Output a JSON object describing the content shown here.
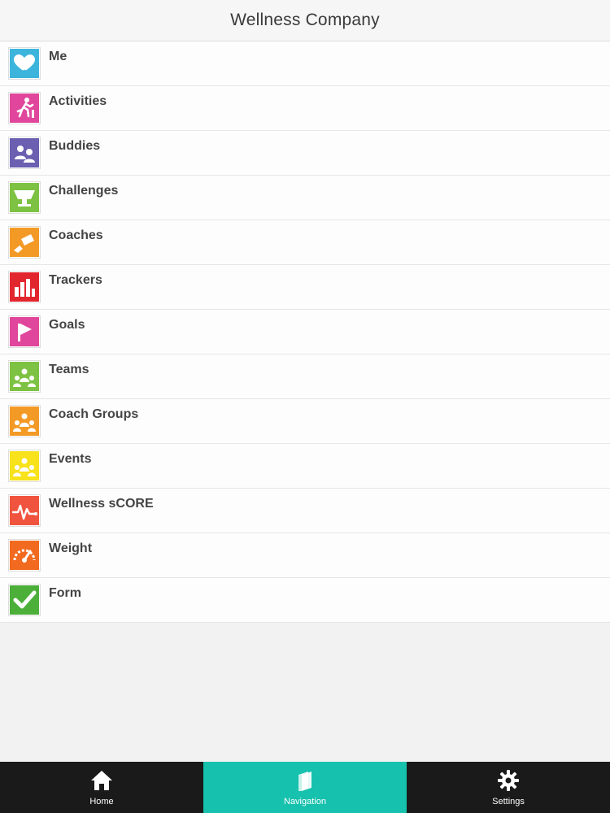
{
  "header": {
    "title": "Wellness Company"
  },
  "menu": [
    {
      "label": "Me",
      "icon": "heart-icon",
      "color": "#3db4dc"
    },
    {
      "label": "Activities",
      "icon": "running-person-icon",
      "color": "#e0469b"
    },
    {
      "label": "Buddies",
      "icon": "buddies-icon",
      "color": "#6a5fb0"
    },
    {
      "label": "Challenges",
      "icon": "trophy-icon",
      "color": "#7dc242"
    },
    {
      "label": "Coaches",
      "icon": "coach-whistle-icon",
      "color": "#f39a26"
    },
    {
      "label": "Trackers",
      "icon": "bar-chart-icon",
      "color": "#e2262e"
    },
    {
      "label": "Goals",
      "icon": "flag-icon",
      "color": "#e0469b"
    },
    {
      "label": "Teams",
      "icon": "team-icon",
      "color": "#7dc242"
    },
    {
      "label": "Coach Groups",
      "icon": "group-icon",
      "color": "#f39a26"
    },
    {
      "label": "Events",
      "icon": "event-group-icon",
      "color": "#f7e21b"
    },
    {
      "label": "Wellness sCORE",
      "icon": "heartbeat-icon",
      "color": "#f0543e"
    },
    {
      "label": "Weight",
      "icon": "gauge-icon",
      "color": "#f26a1f"
    },
    {
      "label": "Form",
      "icon": "checkmark-icon",
      "color": "#4caf3a"
    }
  ],
  "tabs": {
    "home": {
      "label": "Home",
      "icon": "home-icon"
    },
    "navigation": {
      "label": "Navigation",
      "icon": "book-icon",
      "active_color": "#16c1ad"
    },
    "settings": {
      "label": "Settings",
      "icon": "gear-icon"
    }
  }
}
